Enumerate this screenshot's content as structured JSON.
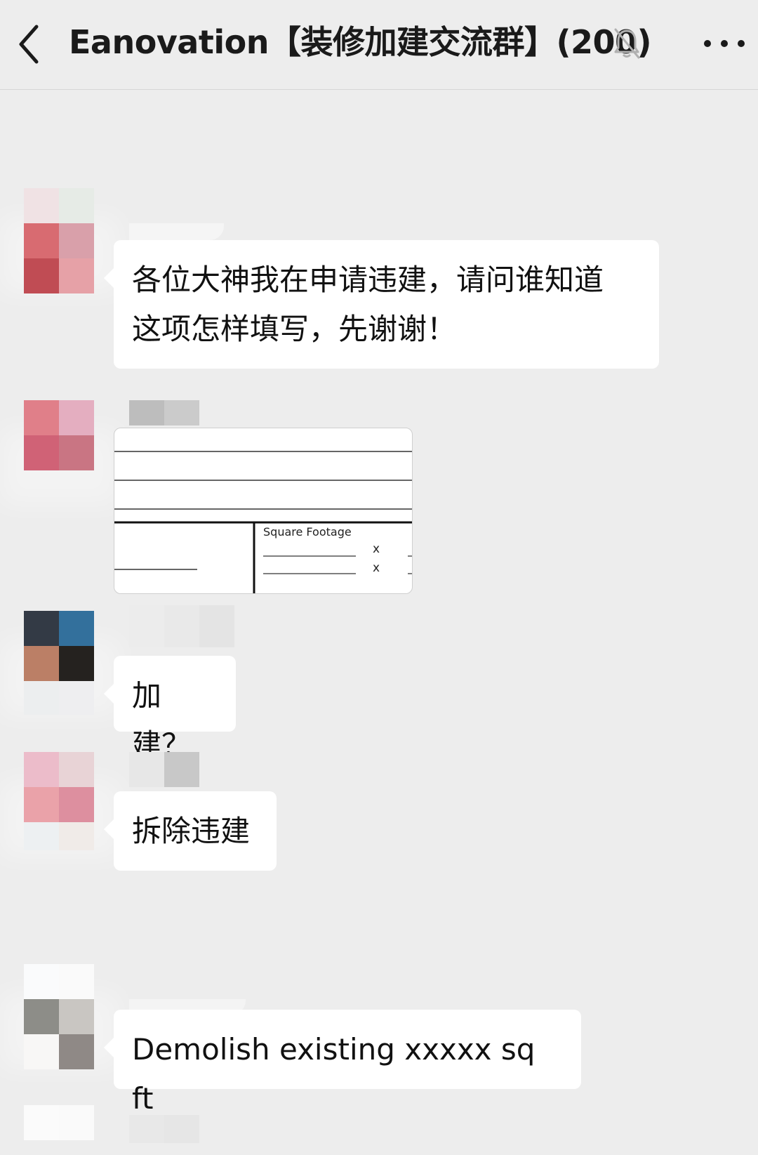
{
  "header": {
    "title": "Eanovation【装修加建交流群】(200)",
    "back_icon": "chevron-left-icon",
    "mute_icon": "bell-off-icon",
    "more_icon": "more-dots-icon"
  },
  "messages": [
    {
      "type": "text",
      "text": "各位大神我在申请违建，请问谁知道\n这项怎样填写，先谢谢！"
    },
    {
      "type": "image",
      "form_label": "Square Footage",
      "x1": "x",
      "x2": "x"
    },
    {
      "type": "text",
      "text": "加建？"
    },
    {
      "type": "text",
      "text": "拆除违建"
    },
    {
      "type": "text",
      "text": "Demolish existing xxxxx sq ft"
    }
  ],
  "colors": {
    "background": "#ededed",
    "bubble": "#ffffff",
    "text": "#111111"
  }
}
